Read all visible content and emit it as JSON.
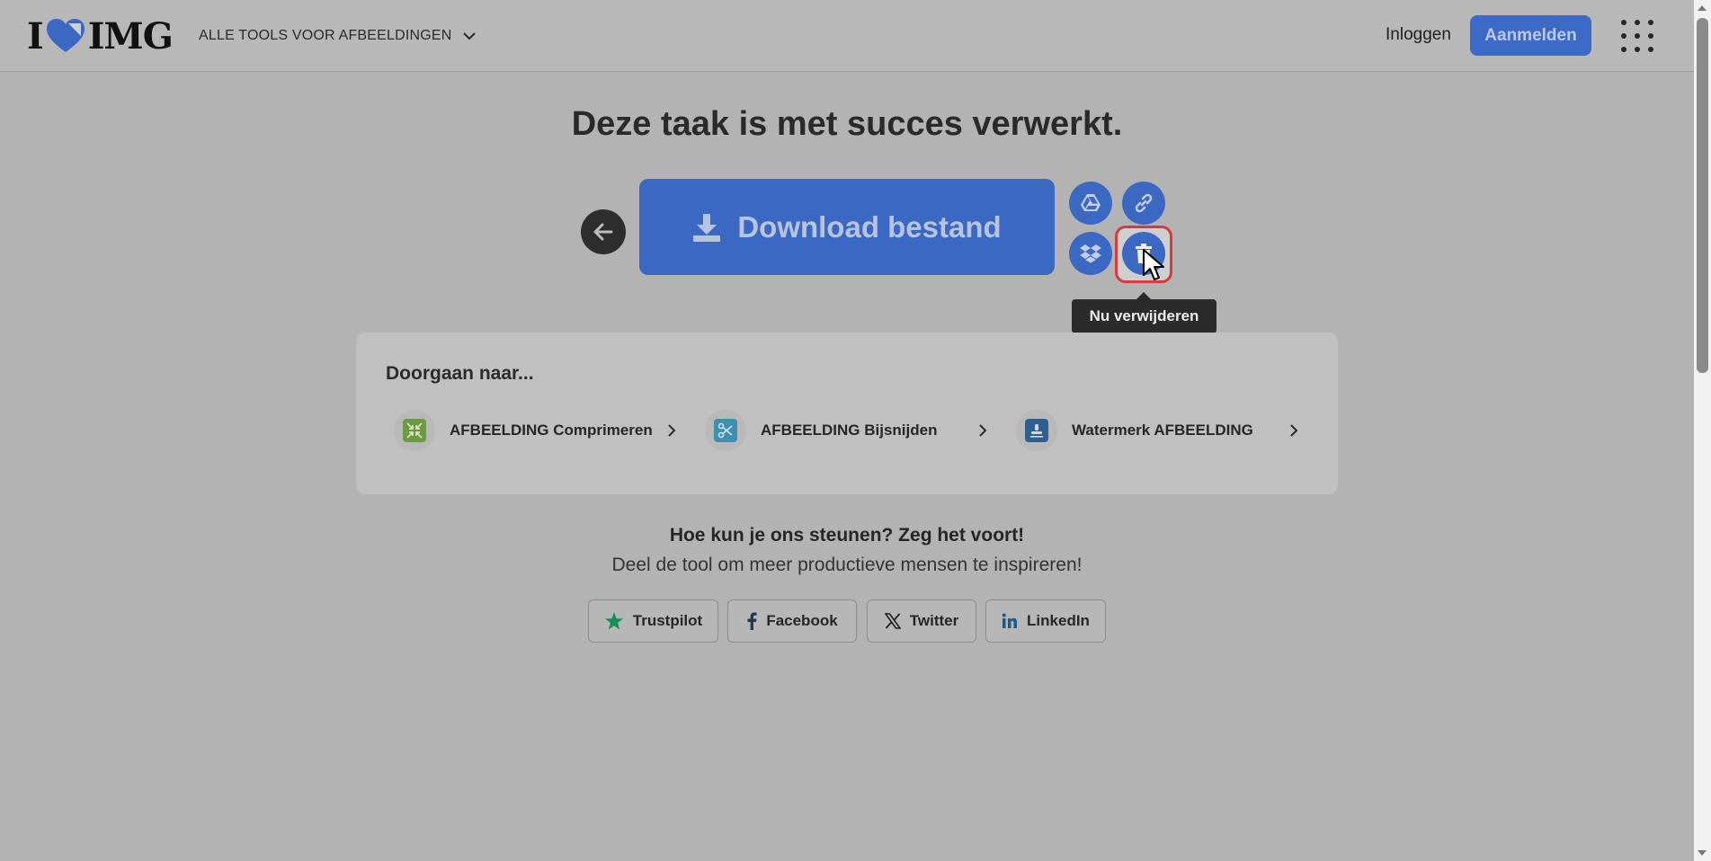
{
  "header": {
    "logo_left": "I",
    "logo_right": "IMG",
    "tools_menu_label": "ALLE TOOLS VOOR AFBEELDINGEN",
    "login_label": "Inloggen",
    "signup_label": "Aanmelden"
  },
  "main": {
    "title": "Deze taak is met succes verwerkt.",
    "download_label": "Download bestand",
    "tooltip": "Nu verwijderen"
  },
  "continue": {
    "title": "Doorgaan naar...",
    "tools": [
      {
        "label": "AFBEELDING Comprimeren",
        "icon": "compress-icon",
        "color": "#6c9a3f"
      },
      {
        "label": "AFBEELDING Bijsnijden",
        "icon": "scissors-icon",
        "color": "#3f8fb0"
      },
      {
        "label": "Watermerk AFBEELDING",
        "icon": "stamp-icon",
        "color": "#2f5f8f"
      }
    ]
  },
  "support": {
    "title": "Hoe kun je ons steunen? Zeg het voort!",
    "subtitle": "Deel de tool om meer productieve mensen te inspireren!",
    "share": [
      {
        "label": "Trustpilot",
        "icon": "star-icon"
      },
      {
        "label": "Facebook",
        "icon": "facebook-icon"
      },
      {
        "label": "Twitter",
        "icon": "x-icon"
      },
      {
        "label": "LinkedIn",
        "icon": "linkedin-icon"
      }
    ]
  },
  "colors": {
    "accent": "#3b68c2",
    "delete_highlight": "#d83a3a",
    "trustpilot": "#1d8a57",
    "linkedin": "#1f5a8a"
  }
}
